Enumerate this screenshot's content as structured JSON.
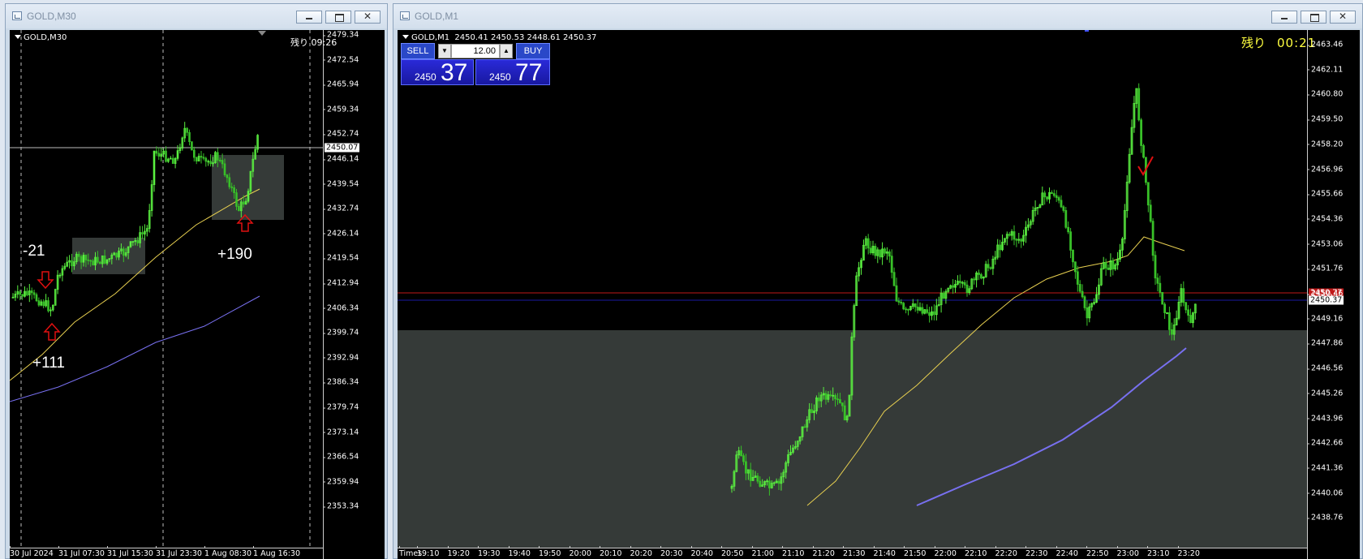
{
  "left_window": {
    "title": "GOLD,M30",
    "symbol_label": "GOLD,M30",
    "timer_label": "残り",
    "timer_value": "09:26",
    "price_tag": "2450.07",
    "y_ticks": [
      "2479.34",
      "2472.54",
      "2465.94",
      "2459.34",
      "2452.74",
      "2446.14",
      "2439.54",
      "2432.74",
      "2426.14",
      "2419.54",
      "2412.94",
      "2406.34",
      "2399.74",
      "2392.94",
      "2386.34",
      "2379.74",
      "2373.14",
      "2366.54",
      "2359.94",
      "2353.34"
    ],
    "x_ticks": [
      "30 Jul 2024",
      "31 Jul 07:30",
      "31 Jul 15:30",
      "31 Jul 23:30",
      "1 Aug 08:30",
      "1 Aug 16:30"
    ],
    "annotations": {
      "minus": "-21",
      "plus_small": "+111",
      "plus_big": "+190"
    }
  },
  "right_window": {
    "title": "GOLD,M1",
    "symbol_label": "GOLD,M1",
    "ohlc": "2450.41 2450.53 2448.61 2450.37",
    "timer_label": "残り",
    "timer_value": "00:21",
    "trade_panel": {
      "sell_label": "SELL",
      "buy_label": "BUY",
      "lot_value": "12.00",
      "sell_big": "2450",
      "sell_small": "37",
      "buy_big": "2450",
      "buy_small": "77"
    },
    "price_tag_bid": "2450.37",
    "price_tag_ask": "2450.77",
    "y_ticks": [
      "2463.46",
      "2462.11",
      "2460.80",
      "2459.50",
      "2458.20",
      "2456.96",
      "2455.66",
      "2454.36",
      "2453.06",
      "2451.76",
      "2450.46",
      "2449.16",
      "2447.86",
      "2446.56",
      "2445.26",
      "2443.96",
      "2442.66",
      "2441.36",
      "2440.06",
      "2438.76"
    ],
    "x_axis_name": "Times",
    "x_ticks": [
      "19:10",
      "19:20",
      "19:30",
      "19:40",
      "19:50",
      "20:00",
      "20:10",
      "20:20",
      "20:30",
      "20:40",
      "20:50",
      "21:00",
      "21:10",
      "21:20",
      "21:30",
      "21:40",
      "21:50",
      "22:00",
      "22:10",
      "22:20",
      "22:30",
      "22:40",
      "22:50",
      "23:00",
      "23:10",
      "23:20"
    ]
  },
  "colors": {
    "bull": "#5af040",
    "bear": "#38c028",
    "ma_fast": "#e8d050",
    "ma_slow": "#7870f0",
    "zone": "#353a38",
    "ask_line": "#c01818",
    "bid_line": "#1a1aa0",
    "arrow": "#e01010"
  }
}
